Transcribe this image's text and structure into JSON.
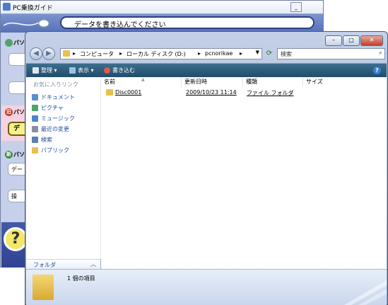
{
  "background_app": {
    "title": "PC乗換ガイド",
    "banner_text": "データを書き込んでください",
    "section_old_label": "パソ",
    "section_new_label": "パソ",
    "section_old_badge": "旧",
    "section_new_badge": "新",
    "top_section_label": "パソ",
    "yellow_button_label": "デ",
    "new_box_label": "デー",
    "bottom_box_label": "操",
    "help_symbol": "?"
  },
  "explorer": {
    "address": {
      "segments": [
        "コンピュータ",
        "ローカル ディスク (D:)",
        "pcnorikae"
      ],
      "separator": "▸"
    },
    "search_placeholder": "検索",
    "toolbar": {
      "organize": "整理",
      "views": "表示",
      "burn": "書き込む"
    },
    "nav_pane": {
      "header": "お気に入りリンク",
      "items": [
        {
          "label": "ドキュメント",
          "icon": "documents-icon",
          "color": "#5a8fd0"
        },
        {
          "label": "ピクチャ",
          "icon": "pictures-icon",
          "color": "#4fa36b"
        },
        {
          "label": "ミュージック",
          "icon": "music-icon",
          "color": "#4a86c8"
        },
        {
          "label": "最近の変更",
          "icon": "recent-icon",
          "color": "#8a8fa0"
        },
        {
          "label": "検索",
          "icon": "search-icon",
          "color": "#5a7fb0"
        },
        {
          "label": "パブリック",
          "icon": "public-folder-icon",
          "color": "#e8c14e"
        }
      ],
      "folder_bar_label": "フォルダ"
    },
    "columns": [
      "名前",
      "更新日時",
      "種類",
      "サイズ"
    ],
    "files": [
      {
        "name": "Disc0001",
        "modified": "2009/10/23 11:14",
        "type": "ファイル フォルダ",
        "size": ""
      }
    ],
    "status": "1 個の項目"
  },
  "colors": {
    "toolbar_bg": "#1f4b68",
    "link_blue": "#1d4da0",
    "folder_yellow": "#e8c14e"
  }
}
